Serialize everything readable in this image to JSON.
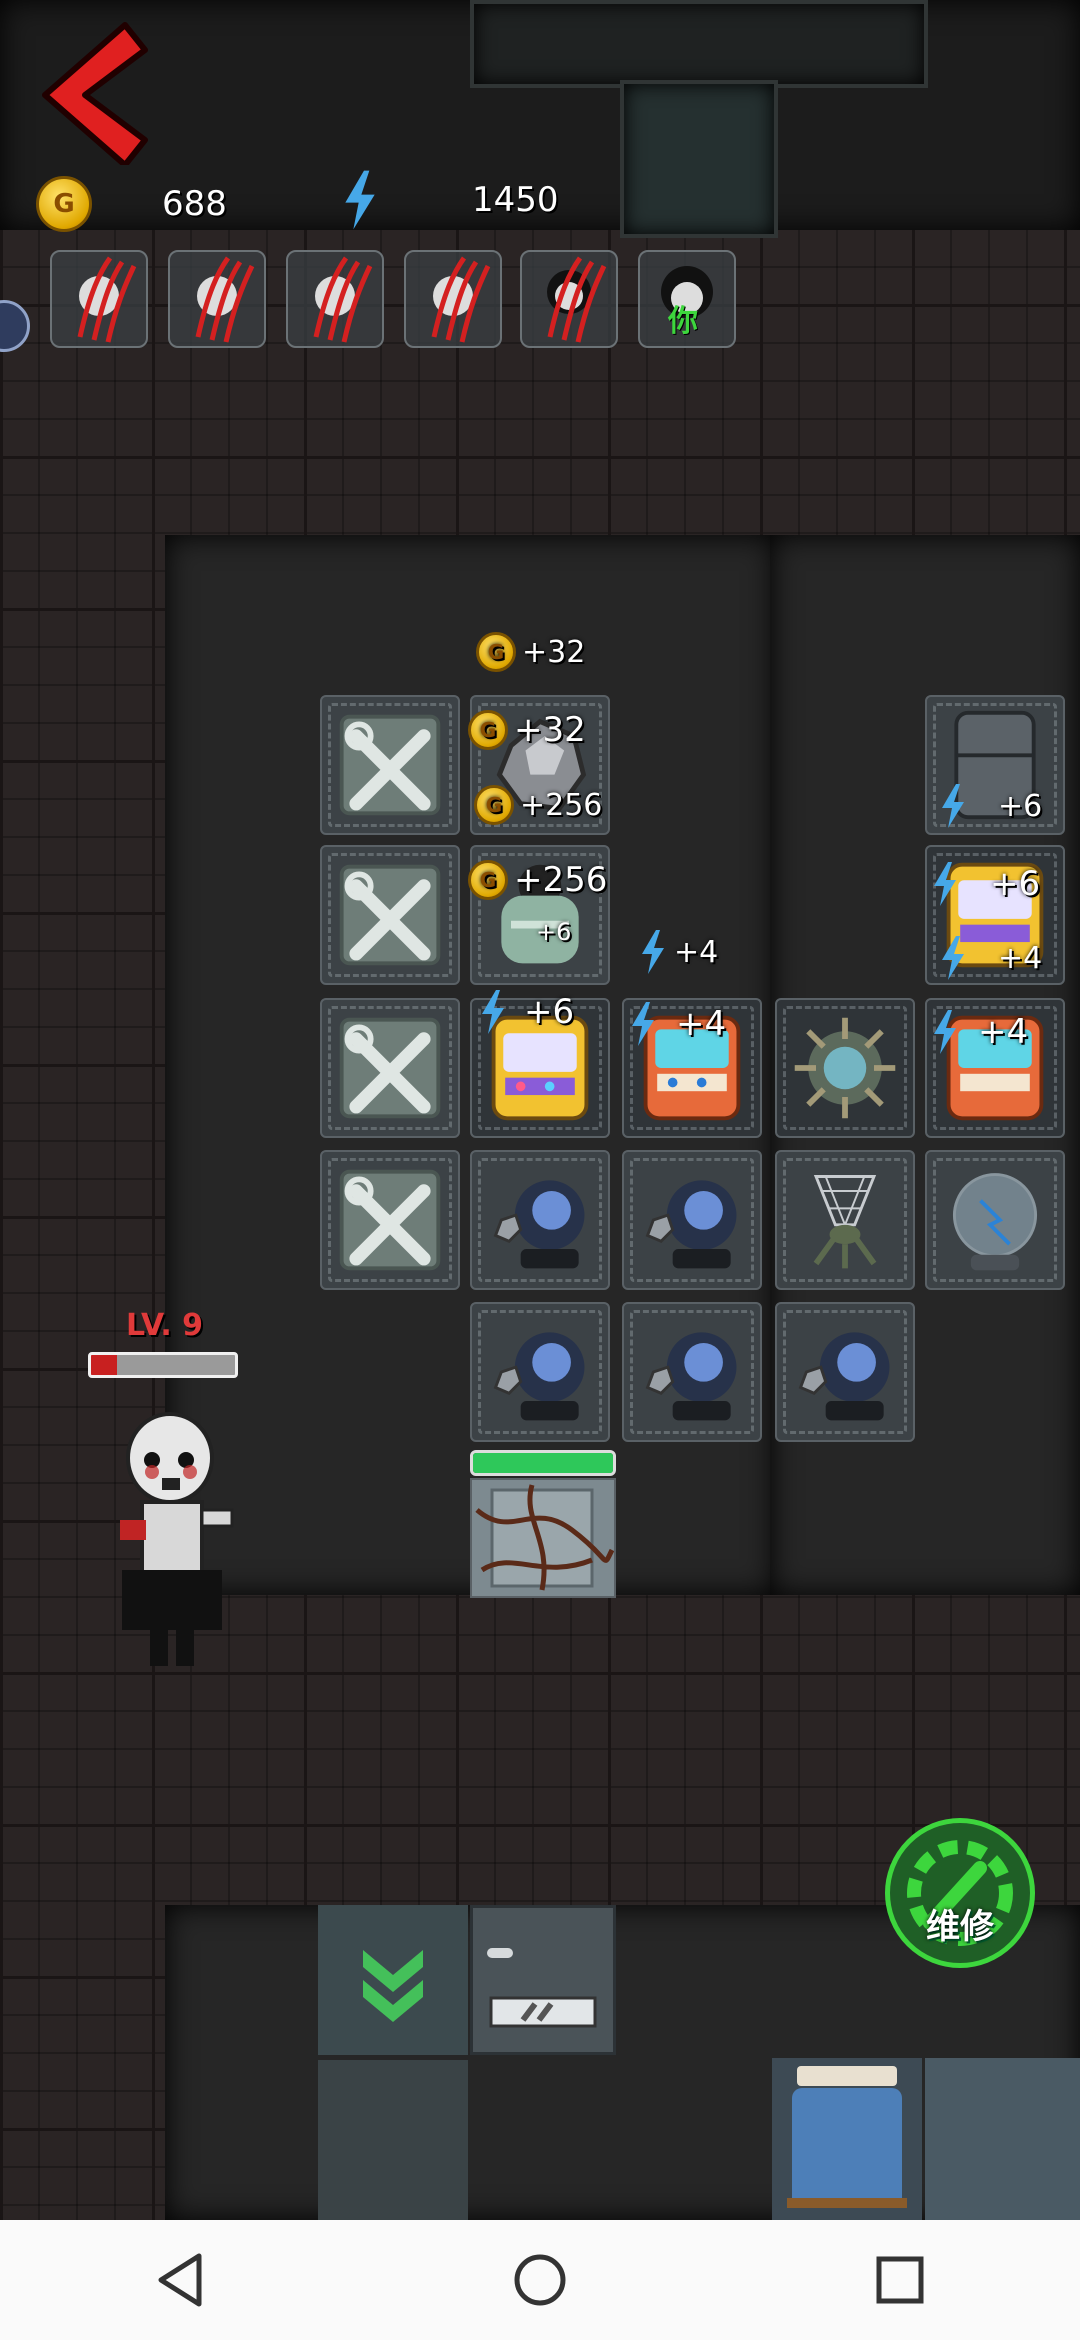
{
  "resources": {
    "gold": "688",
    "energy": "1450"
  },
  "monsters": {
    "count_clawed": 5,
    "marker_label": "你"
  },
  "floating": {
    "coin_top": "+32",
    "coin_mid1": "+32",
    "coin_mid2": "+256",
    "coin_mid3": "+256",
    "machine_small": "+6",
    "energy_fridge": "+6",
    "energy_arcade_r1": "+6",
    "energy_arcade_r2": "+4",
    "energy_open": "+4",
    "energy_arcade_a": "+6",
    "energy_arcade_b": "+4",
    "energy_arcade_c": "+4"
  },
  "enemy": {
    "level": "LV. 9",
    "health_fraction": 0.18
  },
  "door": {
    "health_fraction": 1.0
  },
  "repair_button": {
    "label": "维修"
  },
  "colors": {
    "accent_red": "#e02020",
    "energy_blue": "#46a8e8",
    "repair_green": "#3dd63d",
    "door_green": "#2ec85a"
  }
}
